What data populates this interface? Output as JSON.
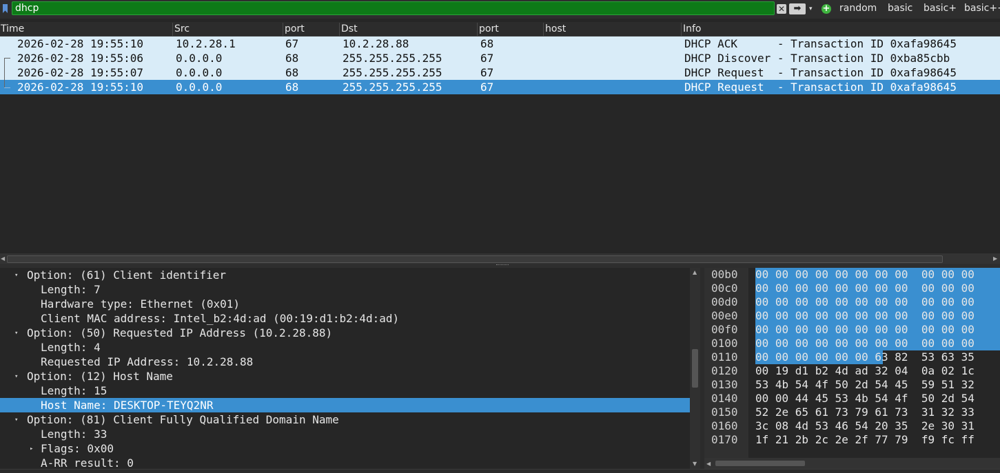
{
  "filter": {
    "value": "dhcp",
    "clear_icon": "✕",
    "apply_icon": "➡",
    "history_icon": "▾",
    "add_icon": "+",
    "buttons": [
      "random",
      "basic",
      "basic+",
      "basic++"
    ]
  },
  "packet_list": {
    "columns": [
      "Time",
      "Src",
      "port",
      "Dst",
      "port",
      "host",
      "Info"
    ],
    "rows": [
      {
        "time": "2026-02-28 19:55:10",
        "src": "10.2.28.1",
        "sport": "67",
        "dst": "10.2.28.88",
        "dport": "68",
        "host": "",
        "info": "DHCP ACK      - Transaction ID 0xafa98645"
      },
      {
        "time": "2026-02-28 19:55:06",
        "src": "0.0.0.0",
        "sport": "68",
        "dst": "255.255.255.255",
        "dport": "67",
        "host": "",
        "info": "DHCP Discover - Transaction ID 0xba85cbb"
      },
      {
        "time": "2026-02-28 19:55:07",
        "src": "0.0.0.0",
        "sport": "68",
        "dst": "255.255.255.255",
        "dport": "67",
        "host": "",
        "info": "DHCP Request  - Transaction ID 0xafa98645"
      },
      {
        "time": "2026-02-28 19:55:10",
        "src": "0.0.0.0",
        "sport": "68",
        "dst": "255.255.255.255",
        "dport": "67",
        "host": "",
        "info": "DHCP Request  - Transaction ID 0xafa98645"
      }
    ],
    "selected_index": 3
  },
  "details": {
    "rows": [
      {
        "text": "Option: (61) Client identifier",
        "expander": "expanded"
      },
      {
        "text": "Length: 7",
        "expander": "none"
      },
      {
        "text": "Hardware type: Ethernet (0x01)",
        "expander": "none"
      },
      {
        "text": "Client MAC address: Intel_b2:4d:ad (00:19:d1:b2:4d:ad)",
        "expander": "none"
      },
      {
        "text": "Option: (50) Requested IP Address (10.2.28.88)",
        "expander": "expanded"
      },
      {
        "text": "Length: 4",
        "expander": "none"
      },
      {
        "text": "Requested IP Address: 10.2.28.88",
        "expander": "none"
      },
      {
        "text": "Option: (12) Host Name",
        "expander": "expanded"
      },
      {
        "text": "Length: 15",
        "expander": "none"
      },
      {
        "text": "Host Name: DESKTOP-TEYQ2NR",
        "expander": "none"
      },
      {
        "text": "Option: (81) Client Fully Qualified Domain Name",
        "expander": "expanded"
      },
      {
        "text": "Length: 33",
        "expander": "none"
      },
      {
        "text": "Flags: 0x00",
        "expander": "collapsed"
      },
      {
        "text": "A-RR result: 0",
        "expander": "none"
      }
    ],
    "selected_index": 9
  },
  "bytes": {
    "rows": [
      {
        "offset": "00b0",
        "hex": "00 00 00 00 00 00 00 00  00 00 00"
      },
      {
        "offset": "00c0",
        "hex": "00 00 00 00 00 00 00 00  00 00 00"
      },
      {
        "offset": "00d0",
        "hex": "00 00 00 00 00 00 00 00  00 00 00"
      },
      {
        "offset": "00e0",
        "hex": "00 00 00 00 00 00 00 00  00 00 00"
      },
      {
        "offset": "00f0",
        "hex": "00 00 00 00 00 00 00 00  00 00 00"
      },
      {
        "offset": "0100",
        "hex": "00 00 00 00 00 00 00 00  00 00 00"
      },
      {
        "offset": "0110",
        "hex": "00 00 00 00 00 00 63 82  53 63 35"
      },
      {
        "offset": "0120",
        "hex": "00 19 d1 b2 4d ad 32 04  0a 02 1c"
      },
      {
        "offset": "0130",
        "hex": "53 4b 54 4f 50 2d 54 45  59 51 32"
      },
      {
        "offset": "0140",
        "hex": "00 00 44 45 53 4b 54 4f  50 2d 54"
      },
      {
        "offset": "0150",
        "hex": "52 2e 65 61 73 79 61 73  31 32 33"
      },
      {
        "offset": "0160",
        "hex": "3c 08 4d 53 46 54 20 35  2e 30 31"
      },
      {
        "offset": "0170",
        "hex": "1f 21 2b 2c 2e 2f 77 79  f9 fc ff"
      }
    ]
  }
}
